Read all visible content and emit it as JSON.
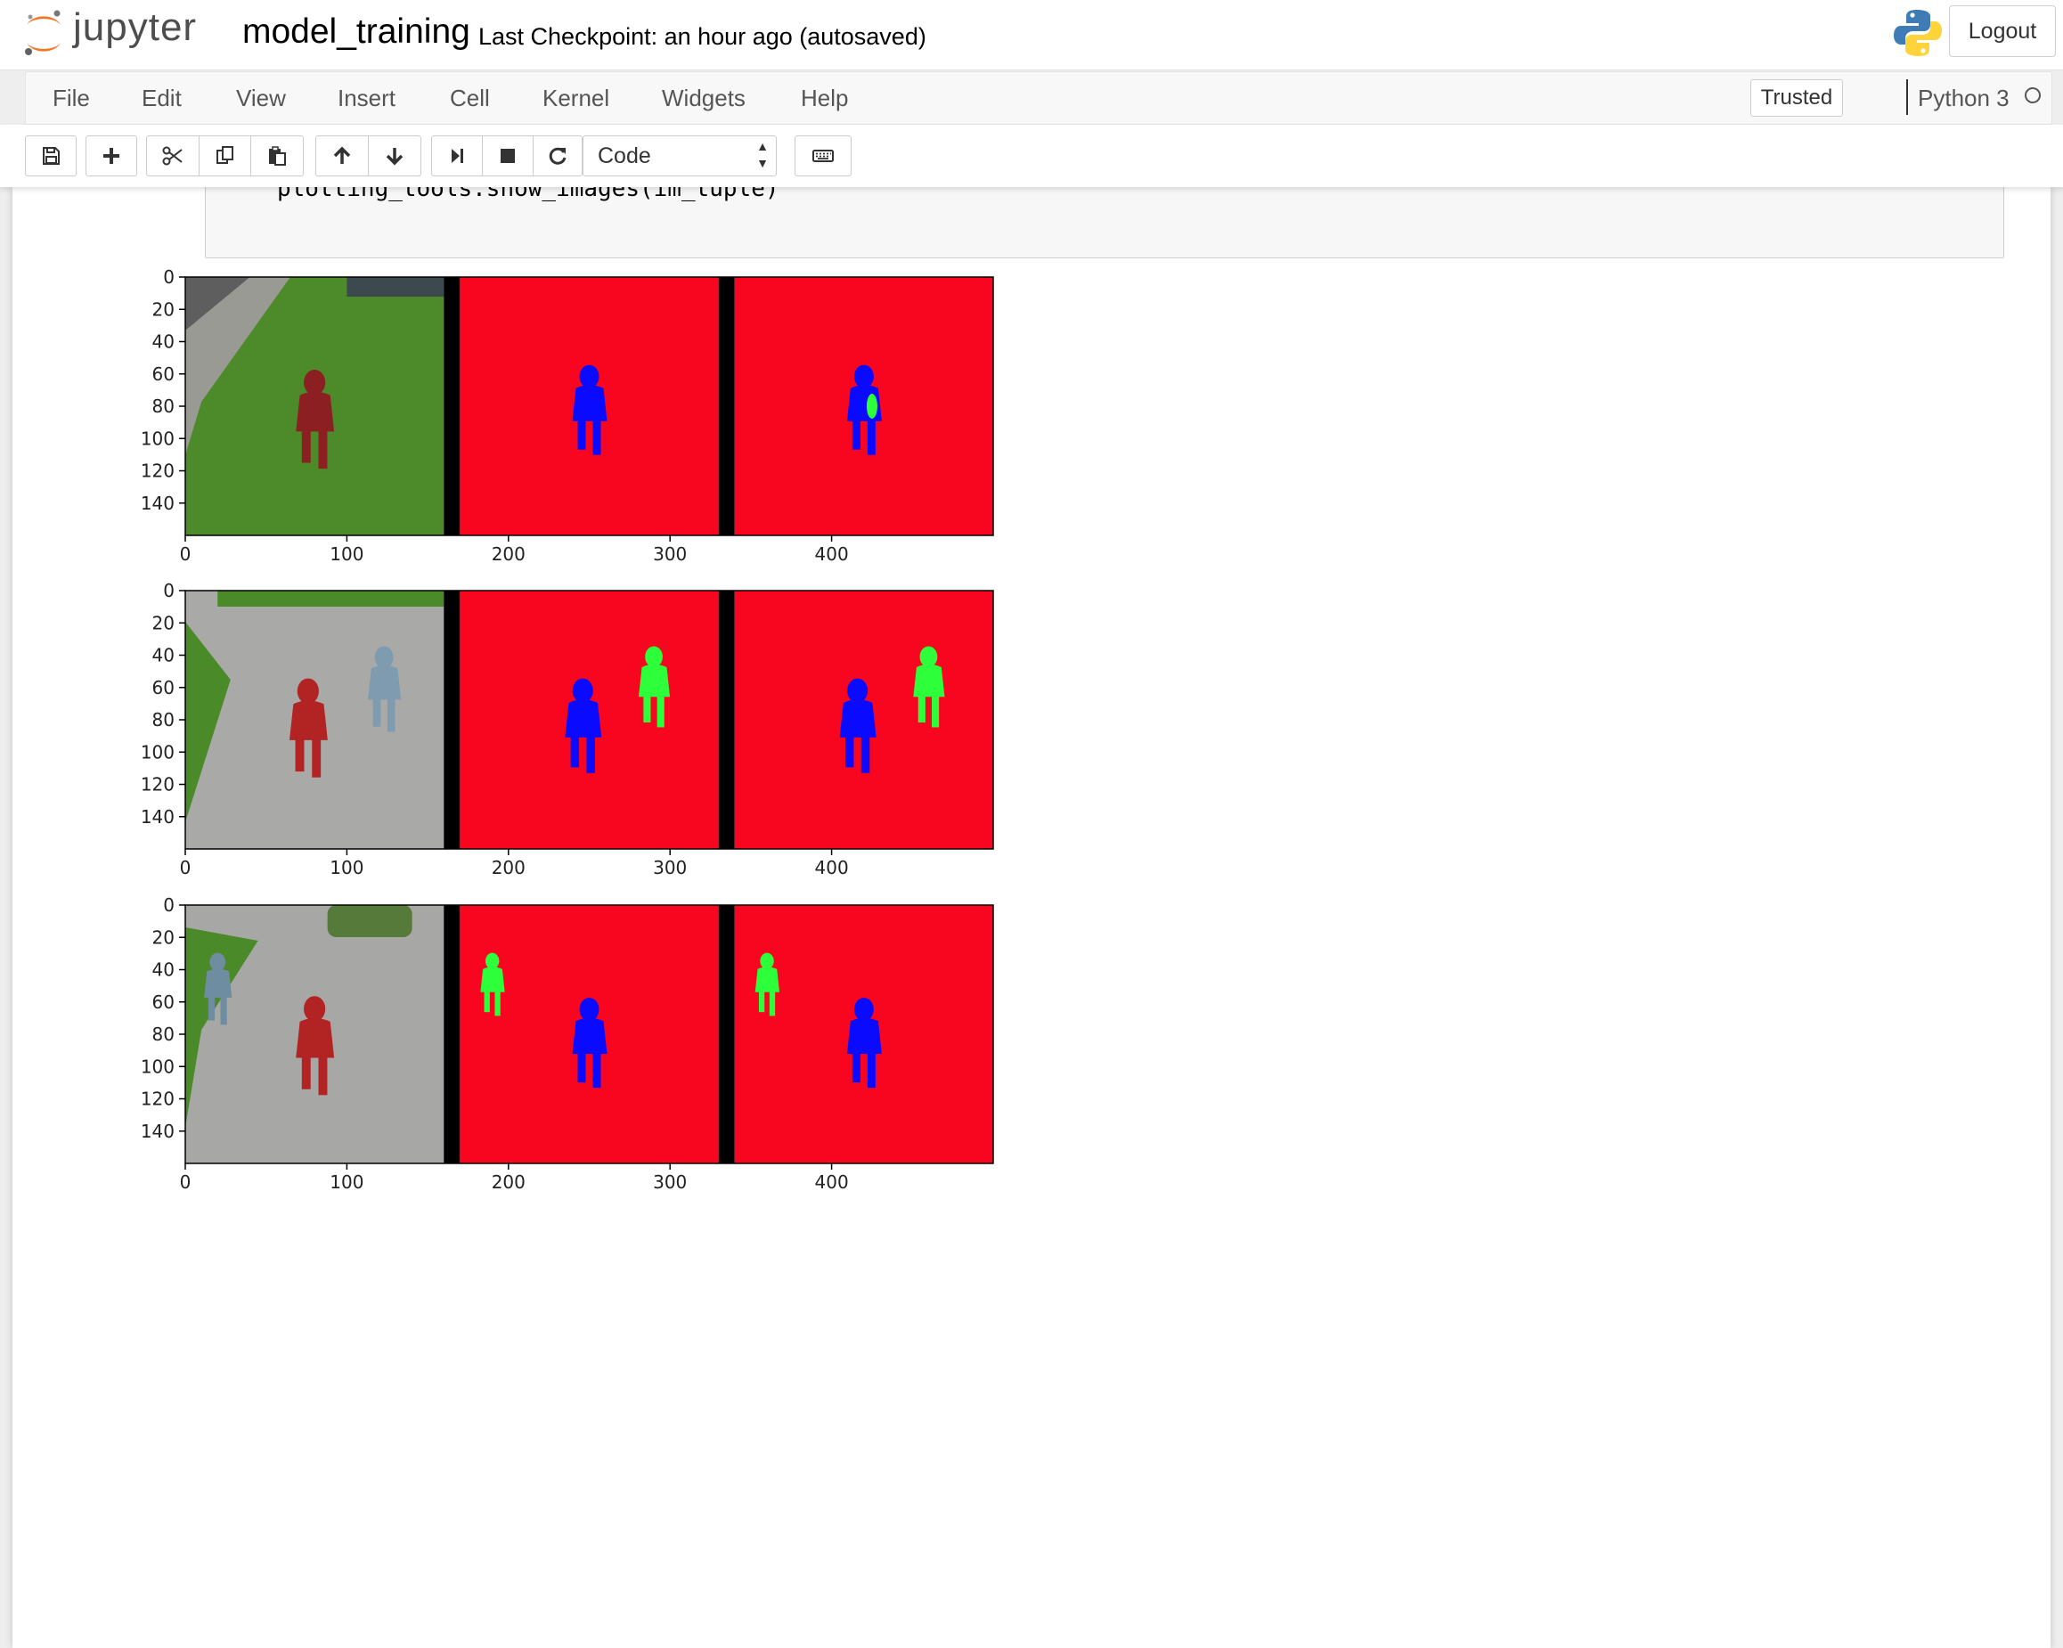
{
  "header": {
    "logo_text": "jupyter",
    "notebook_title": "model_training",
    "checkpoint": "Last Checkpoint: an hour ago (autosaved)",
    "logout_label": "Logout"
  },
  "menu": {
    "items": [
      "File",
      "Edit",
      "View",
      "Insert",
      "Cell",
      "Kernel",
      "Widgets",
      "Help"
    ],
    "trusted_label": "Trusted",
    "kernel_name": "Python 3"
  },
  "toolbar": {
    "buttons": [
      "save-icon",
      "add-cell-icon",
      "cut-icon",
      "copy-icon",
      "paste-icon",
      "move-up-icon",
      "move-down-icon",
      "run-icon",
      "stop-icon",
      "restart-icon"
    ],
    "cell_type": "Code",
    "keyboard_icon": "keyboard-icon"
  },
  "cell": {
    "code": "plotting_tools.show_images(im_tuple)"
  },
  "chart_data": [
    {
      "type": "image",
      "panels": [
        "camera image",
        "ground truth mask",
        "predicted mask"
      ],
      "xticks": [
        0,
        100,
        200,
        300,
        400
      ],
      "yticks": [
        0,
        20,
        40,
        60,
        80,
        100,
        120,
        140
      ],
      "xlim": [
        0,
        500
      ],
      "ylim": [
        160,
        0
      ],
      "colors": {
        "background": "#ff0022",
        "hero": "#0000ff",
        "other_people": "#22ff22"
      }
    },
    {
      "type": "image",
      "panels": [
        "camera image",
        "ground truth mask",
        "predicted mask"
      ],
      "xticks": [
        0,
        100,
        200,
        300,
        400
      ],
      "yticks": [
        0,
        20,
        40,
        60,
        80,
        100,
        120,
        140
      ],
      "xlim": [
        0,
        500
      ],
      "ylim": [
        160,
        0
      ]
    },
    {
      "type": "image",
      "panels": [
        "camera image",
        "ground truth mask",
        "predicted mask"
      ],
      "xticks": [
        0,
        100,
        200,
        300,
        400
      ],
      "yticks": [
        0,
        20,
        40,
        60,
        80,
        100,
        120,
        140
      ],
      "xlim": [
        0,
        500
      ],
      "ylim": [
        160,
        0
      ]
    }
  ]
}
